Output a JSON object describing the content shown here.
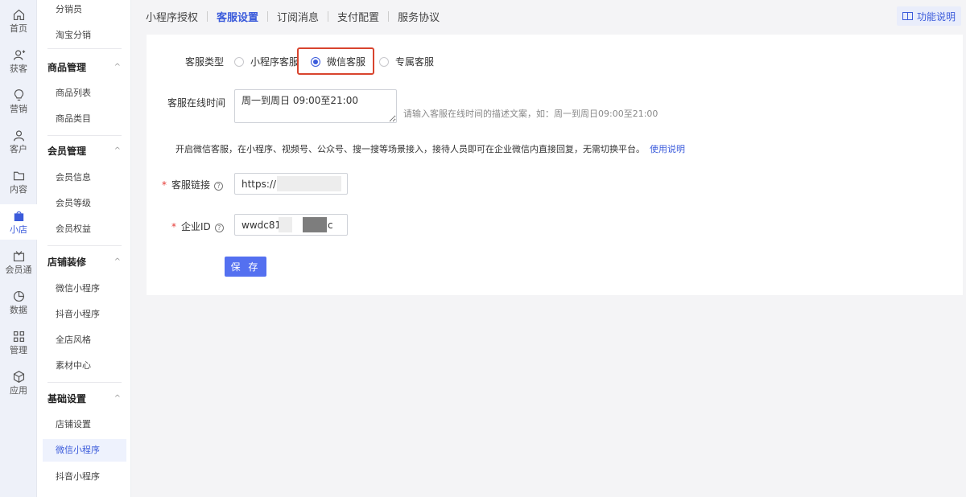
{
  "rail": {
    "items": [
      {
        "label": "首页",
        "icon": "home-icon"
      },
      {
        "label": "获客",
        "icon": "user-add-icon"
      },
      {
        "label": "营销",
        "icon": "bulb-icon"
      },
      {
        "label": "客户",
        "icon": "user-icon"
      },
      {
        "label": "内容",
        "icon": "folder-icon"
      },
      {
        "label": "小店",
        "icon": "shop-bag-icon"
      },
      {
        "label": "会员通",
        "icon": "member-icon"
      },
      {
        "label": "数据",
        "icon": "pie-chart-icon"
      },
      {
        "label": "管理",
        "icon": "grid-icon"
      },
      {
        "label": "应用",
        "icon": "cube-icon"
      }
    ],
    "active": "小店"
  },
  "menu": {
    "top_items": [
      "分销员",
      "淘宝分销"
    ],
    "groups": [
      {
        "title": "商品管理",
        "items": [
          "商品列表",
          "商品类目"
        ]
      },
      {
        "title": "会员管理",
        "items": [
          "会员信息",
          "会员等级",
          "会员权益"
        ]
      },
      {
        "title": "店铺装修",
        "items": [
          "微信小程序",
          "抖音小程序",
          "全店风格",
          "素材中心"
        ]
      },
      {
        "title": "基础设置",
        "items": [
          "店铺设置",
          "微信小程序",
          "抖音小程序"
        ]
      }
    ],
    "active_item": "基础设置/微信小程序",
    "chevron": "^"
  },
  "tabs": {
    "items": [
      "小程序授权",
      "客服设置",
      "订阅消息",
      "支付配置",
      "服务协议"
    ],
    "active": "客服设置"
  },
  "help_button": {
    "label": "功能说明",
    "icon": "book-icon"
  },
  "form": {
    "service_type": {
      "label": "客服类型",
      "options": [
        "小程序客服",
        "微信客服",
        "专属客服"
      ],
      "selected": "微信客服"
    },
    "online_time": {
      "label": "客服在线时间",
      "value": "周一到周日 09:00至21:00",
      "hint": "请输入客服在线时间的描述文案，如：周一到周日09:00至21:00"
    },
    "note": {
      "text": "开启微信客服，在小程序、视频号、公众号、搜一搜等场景接入，接待人员即可在企业微信内直接回复，无需切换平台。",
      "link": "使用说明"
    },
    "service_link": {
      "label": "客服链接",
      "required_mark": "*",
      "value": "https://",
      "help_mark": "?"
    },
    "corp_id": {
      "label": "企业ID",
      "required_mark": "*",
      "value": "wwdc814",
      "value_tail": "c",
      "help_mark": "?"
    },
    "save_label": "保 存"
  },
  "colors": {
    "accent": "#3b5bdb",
    "button": "#5470f0",
    "highlight": "#d8442e",
    "required": "#e53935"
  }
}
